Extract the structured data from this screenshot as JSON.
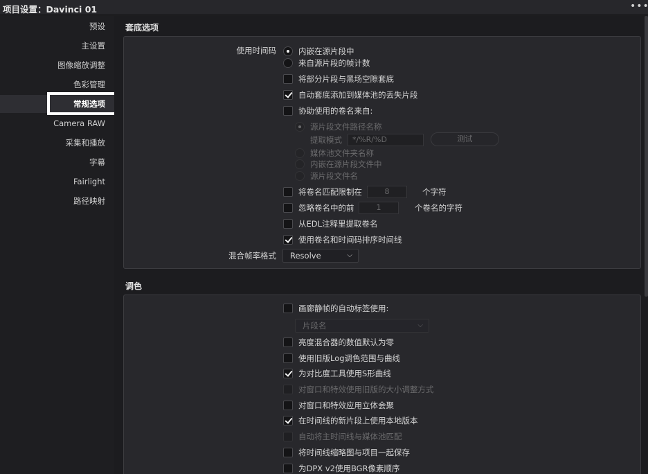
{
  "window": {
    "title": "项目设置：Davinci 01",
    "menu_icon": "more-dots-icon"
  },
  "sidebar": {
    "items": [
      {
        "label": "预设"
      },
      {
        "label": "主设置"
      },
      {
        "label": "图像缩放调整"
      },
      {
        "label": "色彩管理"
      },
      {
        "label": "常规选项",
        "active": true
      },
      {
        "label": "Camera RAW"
      },
      {
        "label": "采集和播放"
      },
      {
        "label": "字幕"
      },
      {
        "label": "Fairlight"
      },
      {
        "label": "路径映射"
      }
    ]
  },
  "conform": {
    "heading": "套底选项",
    "timecode_label": "使用时间码",
    "radio_embedded": "内嵌在源片段中",
    "radio_frame_count": "来自源片段的帧计数",
    "cb_assist_gap": "将部分片段与黑场空隙套底",
    "cb_auto_add": "自动套底添加到媒体池的丢失片段",
    "cb_reel_from": "协助使用的卷名来自:",
    "reel_source_path": "源片段文件路径名称",
    "extract_mode_label": "提取模式",
    "extract_mode_value": "*/%R/%D",
    "test_button": "测试",
    "reel_media_folder": "媒体池文件夹名称",
    "reel_embedded_file": "内嵌在源片段文件中",
    "reel_file_name": "源片段文件名",
    "cb_limit_reel": "将卷名匹配限制在",
    "limit_value": "8",
    "limit_suffix": "个字符",
    "cb_ignore_prefix": "忽略卷名中的前",
    "ignore_value": "1",
    "ignore_suffix": "个卷名的字符",
    "cb_edl_reel": "从EDL注释里提取卷名",
    "cb_sort_timeline": "使用卷名和时间码排序时间线",
    "mixed_fps_label": "混合帧率格式",
    "mixed_fps_value": "Resolve"
  },
  "color": {
    "heading": "调色",
    "cb_gallery_label": "画廊静帧的自动标签使用:",
    "gallery_select_value": "片段名",
    "cb_luma_mixer": "亮度混合器的数值默认为零",
    "cb_legacy_log": "使用旧版Log调色范围与曲线",
    "cb_s_curve": "为对比度工具使用S形曲线",
    "cb_legacy_resize": "对窗口和特效使用旧版的大小调整方式",
    "cb_stereo": "对窗口和特效应用立体会聚",
    "cb_local_version": "在时间线的新片段上使用本地版本",
    "cb_auto_match": "自动将主时间线与媒体池匹配",
    "cb_save_thumbs": "将时间线缩略图与项目一起保存",
    "cb_dpx_bgr": "为DPX v2使用BGR像素顺序"
  }
}
